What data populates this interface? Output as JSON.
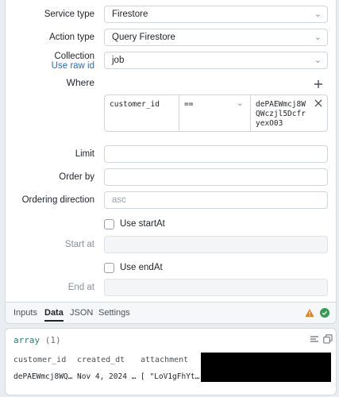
{
  "form": {
    "service_type": {
      "label": "Service type",
      "value": "Firestore"
    },
    "action_type": {
      "label": "Action type",
      "value": "Query Firestore"
    },
    "collection": {
      "label": "Collection",
      "link": "Use raw id",
      "value": "job"
    },
    "where": {
      "label": "Where",
      "add_icon": "plus-icon",
      "field": "customer_id",
      "operator": "==",
      "value": "dePAEWmcj8WQWczjl5DcfryexO03"
    },
    "limit": {
      "label": "Limit",
      "value": ""
    },
    "order_by": {
      "label": "Order by",
      "value": ""
    },
    "ordering_direction": {
      "label": "Ordering direction",
      "placeholder": "asc"
    },
    "use_start_at": {
      "label": "Use startAt",
      "checked": false
    },
    "start_at": {
      "label": "Start at",
      "value": ""
    },
    "use_end_at": {
      "label": "Use endAt",
      "checked": false
    },
    "end_at": {
      "label": "End at",
      "value": ""
    }
  },
  "tabs": {
    "items": [
      "Inputs",
      "Data",
      "JSON",
      "Settings"
    ],
    "active": "Data",
    "status": {
      "warning_color": "#e0801f",
      "success_color": "#2e9f4f"
    }
  },
  "result": {
    "type": "array",
    "count": "(1)",
    "columns": [
      "customer_id",
      "created_dt",
      "attachment"
    ],
    "row": [
      "dePAEWmcj8WQ…",
      "Nov 4, 2024 …",
      "[ \"LoV1gFhYt…"
    ],
    "accent": "#2f7d6b"
  }
}
